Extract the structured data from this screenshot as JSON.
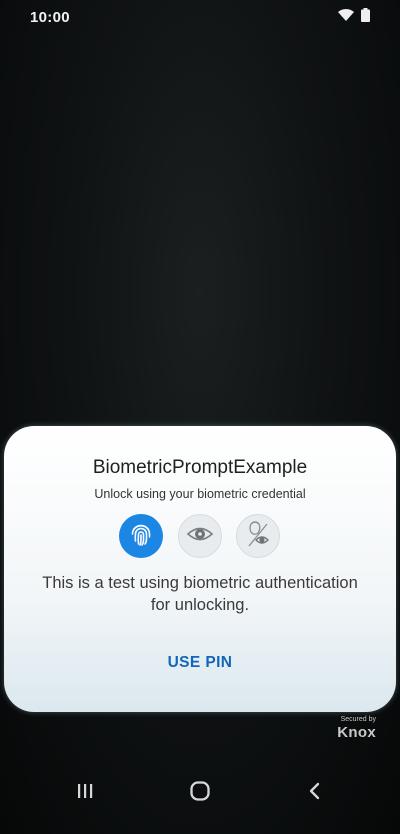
{
  "status_bar": {
    "time": "10:00",
    "icons": [
      "wifi-icon",
      "battery-icon"
    ]
  },
  "dialog": {
    "title": "BiometricPromptExample",
    "subtitle": "Unlock using your biometric credential",
    "biometric_options": [
      {
        "icon": "fingerprint-icon",
        "selected": true
      },
      {
        "icon": "iris-scan-icon",
        "selected": false
      },
      {
        "icon": "face-recognition-icon",
        "selected": false
      }
    ],
    "description_line1": "This is a test using biometric authentication",
    "description_line2": "for unlocking.",
    "use_pin_label": "USE PIN"
  },
  "knox_badge": {
    "secured_by": "Secured by",
    "brand": "Knox"
  },
  "nav_bar": {
    "buttons": [
      "recents-icon",
      "home-icon",
      "back-icon"
    ]
  },
  "colors": {
    "accent": "#1b86e3",
    "link": "#1266b8",
    "background": "#07090a"
  }
}
